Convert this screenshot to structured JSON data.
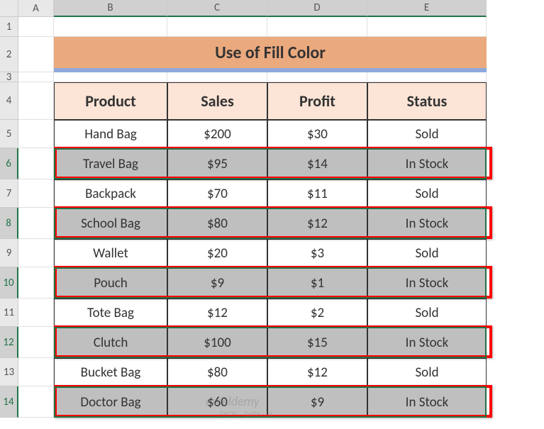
{
  "columns": [
    "A",
    "B",
    "C",
    "D",
    "E"
  ],
  "rows": [
    "1",
    "2",
    "3",
    "4",
    "5",
    "6",
    "7",
    "8",
    "9",
    "10",
    "11",
    "12",
    "13",
    "14"
  ],
  "title": "Use of Fill Color",
  "headers": {
    "product": "Product",
    "sales": "Sales",
    "profit": "Profit",
    "status": "Status"
  },
  "data": [
    {
      "product": "Hand Bag",
      "sales": "$200",
      "profit": "$30",
      "status": "Sold",
      "highlighted": false
    },
    {
      "product": "Travel Bag",
      "sales": "$95",
      "profit": "$14",
      "status": "In Stock",
      "highlighted": true
    },
    {
      "product": "Backpack",
      "sales": "$70",
      "profit": "$11",
      "status": "Sold",
      "highlighted": false
    },
    {
      "product": "School Bag",
      "sales": "$80",
      "profit": "$12",
      "status": "In Stock",
      "highlighted": true
    },
    {
      "product": "Wallet",
      "sales": "$20",
      "profit": "$3",
      "status": "Sold",
      "highlighted": false
    },
    {
      "product": "Pouch",
      "sales": "$9",
      "profit": "$1",
      "status": "In Stock",
      "highlighted": true
    },
    {
      "product": "Tote Bag",
      "sales": "$12",
      "profit": "$2",
      "status": "Sold",
      "highlighted": false
    },
    {
      "product": "Clutch",
      "sales": "$100",
      "profit": "$15",
      "status": "In Stock",
      "highlighted": true
    },
    {
      "product": "Bucket Bag",
      "sales": "$80",
      "profit": "$12",
      "status": "Sold",
      "highlighted": false
    },
    {
      "product": "Doctor Bag",
      "sales": "$60",
      "profit": "$9",
      "status": "In Stock",
      "highlighted": true
    }
  ],
  "selected_rows": [
    6,
    8,
    10,
    12,
    14
  ],
  "watermark": "exceldemy",
  "watermark_sub": "EXCEL · DATA · BI"
}
